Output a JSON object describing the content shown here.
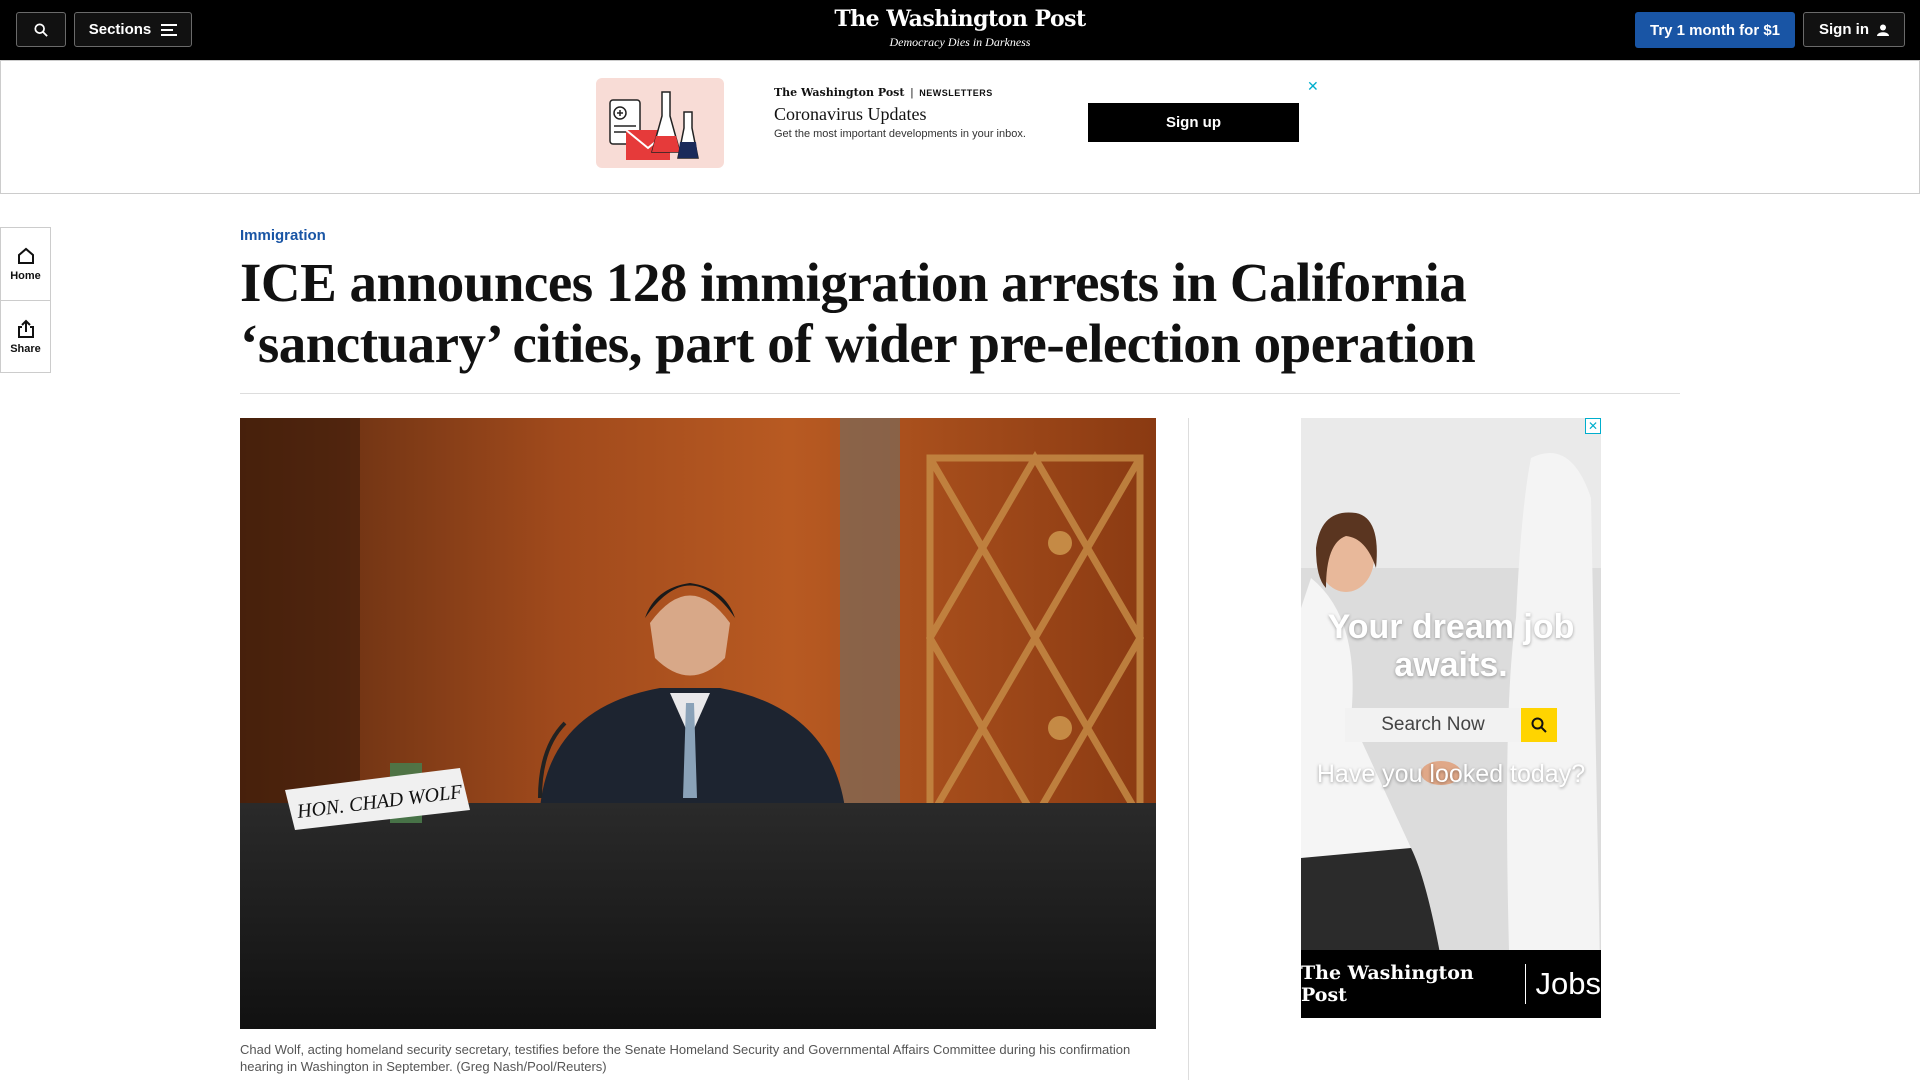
{
  "header": {
    "sections_label": "Sections",
    "logo": "The Washington Post",
    "tagline": "Democracy Dies in Darkness",
    "subscribe_label": "Try 1 month for $1",
    "signin_label": "Sign in"
  },
  "newsletter_ad": {
    "brand": "The Washington Post",
    "tag": "NEWSLETTERS",
    "title": "Coronavirus Updates",
    "subtitle": "Get the most important developments in your inbox.",
    "button_label": "Sign up",
    "close_glyph": "✕"
  },
  "rail": {
    "home_label": "Home",
    "share_label": "Share"
  },
  "article": {
    "kicker": "Immigration",
    "headline": "ICE announces 128 immigration arrests in California ‘sanctuary’ cities, part of wider pre-election operation",
    "nameplate": "HON. CHAD WOLF",
    "caption": "Chad Wolf, acting homeland security secretary, testifies before the Senate Homeland Security and Governmental Affairs Committee during his confirmation hearing in Washington in September. (Greg Nash/Pool/Reuters)"
  },
  "jobs_ad": {
    "headline": "Your dream job awaits.",
    "search_label": "Search Now",
    "question": "Have you looked today?",
    "brand": "The Washington Post",
    "jobs_label": "Jobs",
    "close_glyph": "✕"
  },
  "colors": {
    "accent_blue": "#1955a5",
    "nav_bg": "#000000",
    "ad_close": "#00aecd",
    "search_yellow": "#ffd400"
  }
}
